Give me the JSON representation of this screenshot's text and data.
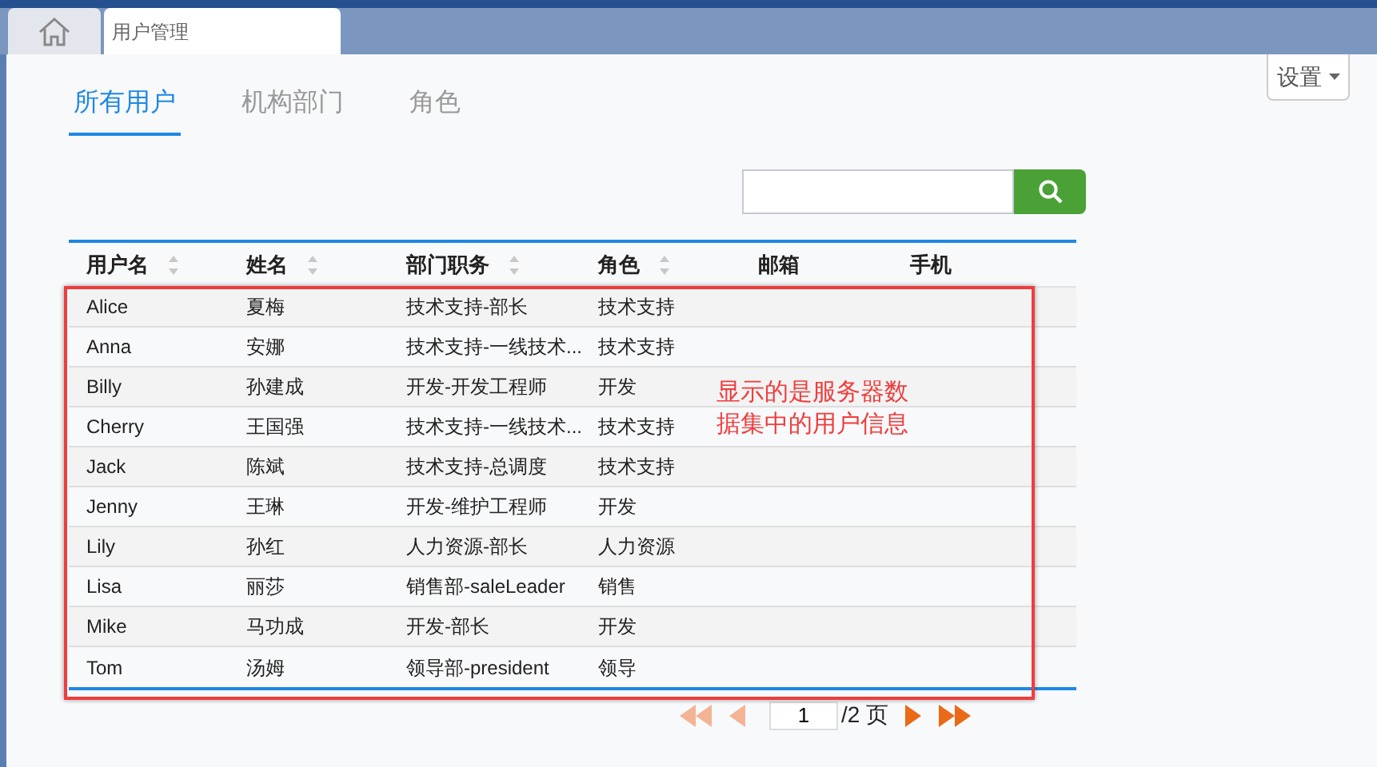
{
  "window_tabs": [
    {
      "kind": "home",
      "selected": false
    },
    {
      "kind": "page",
      "label": "用户管理",
      "selected": true
    }
  ],
  "settings_button": {
    "label": "设置"
  },
  "tabs": [
    {
      "label": "所有用户",
      "selected": true
    },
    {
      "label": "机构部门",
      "selected": false
    },
    {
      "label": "角色",
      "selected": false
    }
  ],
  "table": {
    "columns": [
      {
        "label": "用户名",
        "sortable": true
      },
      {
        "label": "姓名",
        "sortable": true
      },
      {
        "label": "部门职务",
        "sortable": true
      },
      {
        "label": "角色",
        "sortable": true
      },
      {
        "label": "邮箱",
        "sortable": false
      },
      {
        "label": "手机",
        "sortable": false
      }
    ],
    "rows": [
      [
        "Alice",
        "夏梅",
        "技术支持-部长",
        "技术支持"
      ],
      [
        "Anna",
        "安娜",
        "技术支持-一线技术...",
        "技术支持"
      ],
      [
        "Billy",
        "孙建成",
        "开发-开发工程师",
        "开发"
      ],
      [
        "Cherry",
        "王国强",
        "技术支持-一线技术...",
        "技术支持"
      ],
      [
        "Jack",
        "陈斌",
        "技术支持-总调度",
        "技术支持"
      ],
      [
        "Jenny",
        "王琳",
        "开发-维护工程师",
        "开发"
      ],
      [
        "Lily",
        "孙红",
        "人力资源-部长",
        "人力资源"
      ],
      [
        "Lisa",
        "丽莎",
        "销售部-saleLeader",
        "销售"
      ],
      [
        "Mike",
        "马功成",
        "开发-部长",
        "开发"
      ],
      [
        "Tom",
        "汤姆",
        "领导部-president",
        "领导"
      ]
    ]
  },
  "annotation": {
    "lines": [
      "显示的是服务器数",
      "据集中的用户信息"
    ]
  },
  "pagination": {
    "first": {
      "disabled": true
    },
    "prev": {
      "disabled": true
    },
    "page": "1",
    "total": "/2 页",
    "next": {
      "disabled": false
    },
    "last": {
      "disabled": false
    }
  }
}
